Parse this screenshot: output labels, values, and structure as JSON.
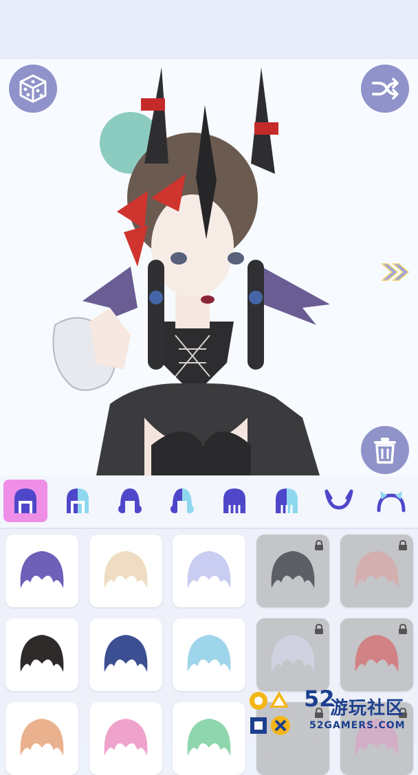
{
  "toolbar": {
    "dice_icon": "dice-icon",
    "shuffle_icon": "shuffle-icon",
    "trash_icon": "trash-icon",
    "next_icon": "double-chevron-right-icon"
  },
  "tabs": [
    {
      "name": "hair-full",
      "active": true
    },
    {
      "name": "hair-back-1",
      "active": false
    },
    {
      "name": "hair-curly",
      "active": false
    },
    {
      "name": "hair-side",
      "active": false
    },
    {
      "name": "hair-long",
      "active": false
    },
    {
      "name": "hair-long-split",
      "active": false
    },
    {
      "name": "horns",
      "active": false
    },
    {
      "name": "headband",
      "active": false
    }
  ],
  "items": [
    {
      "color": "#6e5fb8",
      "locked": false
    },
    {
      "color": "#efdcc2",
      "locked": false
    },
    {
      "color": "#c9cdf1",
      "locked": false
    },
    {
      "color": "#3a3c46",
      "locked": true
    },
    {
      "color": "#d8a7a8",
      "locked": true
    },
    {
      "color": "#2e2a2a",
      "locked": false
    },
    {
      "color": "#3c4f93",
      "locked": false
    },
    {
      "color": "#9fd5ea",
      "locked": false
    },
    {
      "color": "#d5d6e8",
      "locked": true
    },
    {
      "color": "#d56b6d",
      "locked": true
    },
    {
      "color": "#e9b18e",
      "locked": false
    },
    {
      "color": "#efa3cc",
      "locked": false
    },
    {
      "color": "#8fd6ae",
      "locked": false
    },
    {
      "color": "#c4c5c8",
      "locked": true
    },
    {
      "color": "#d8a5c7",
      "locked": true
    }
  ],
  "watermark": {
    "number": "52",
    "chinese": "游玩社区",
    "english": "52GAMERS.COM"
  },
  "colors": {
    "accent": "#8f93c9",
    "active_tab": "#ee8ee6",
    "tab_icon": "#4f47c9"
  }
}
